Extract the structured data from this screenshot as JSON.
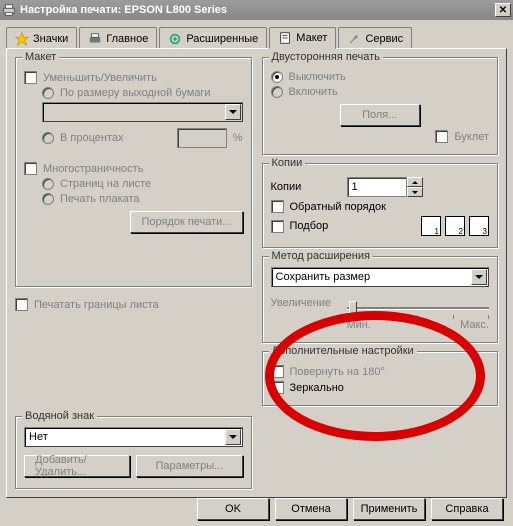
{
  "window": {
    "title": "Настройка печати: EPSON L800 Series"
  },
  "tabs": {
    "icons": "Значки",
    "main": "Главное",
    "advanced": "Расширенные",
    "layout": "Макет",
    "service": "Сервис"
  },
  "layout": {
    "legend": "Макет",
    "reduce_enlarge": "Уменьшить/Увеличить",
    "fit_to_output": "По размеру выходной бумаги",
    "percent_radio": "В процентах",
    "percent_suffix": "%",
    "multipage_legend_hidden": "",
    "multipage": "Многостраничность",
    "pages_on_sheet": "Страниц на листе",
    "poster": "Печать плаката",
    "print_order_btn": "Порядок печати...",
    "print_borders": "Печатать границы листа",
    "watermark_legend": "Водяной знак",
    "watermark_value": "Нет",
    "add_remove_btn": "Добавить/Удалить...",
    "params_btn": "Параметры..."
  },
  "duplex": {
    "legend": "Двусторонняя печать",
    "off": "Выключить",
    "on": "Включить",
    "margins_btn": "Поля...",
    "booklet": "Буклет"
  },
  "copies": {
    "legend": "Копии",
    "label": "Копии",
    "value": "1",
    "reverse": "Обратный порядок",
    "collate": "Подбор"
  },
  "expand": {
    "legend": "Метод расширения",
    "value": "Сохранить размер",
    "enlarge": "Увеличение",
    "min": "Мин.",
    "max": "Макс."
  },
  "extra": {
    "legend": "Дополнительные настройки",
    "rotate": "Повернуть на 180°",
    "mirror": "Зеркально"
  },
  "buttons": {
    "ok": "OK",
    "cancel": "Отмена",
    "apply": "Применить",
    "help": "Справка"
  }
}
